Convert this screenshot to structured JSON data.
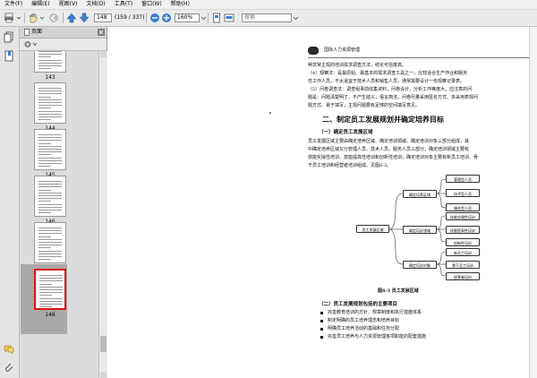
{
  "menu": [
    "文件(F)",
    "编辑(E)",
    "视图(V)",
    "文档(D)",
    "工具(T)",
    "窗口(W)",
    "帮助(H)"
  ],
  "toolbar": {
    "page_value": "148",
    "page_total": "(159 / 337)",
    "zoom": "160%",
    "search_placeholder": "搜索"
  },
  "panel": {
    "title": "页面"
  },
  "thumbnails": [
    {
      "label": "143",
      "selected": false
    },
    {
      "label": "144",
      "selected": false
    },
    {
      "label": "145",
      "selected": false
    },
    {
      "label": "146",
      "selected": false
    },
    {
      "label": "147",
      "selected": false
    },
    {
      "label": "148",
      "selected": true
    }
  ],
  "document": {
    "header": "国际人力资源管理",
    "para1": [
      "种非常主观的培训需求调查方法，结论可信度高。",
      "（4）观察法：是最原始、最基本的需求调查工具之一，比较适合生产作业和服务",
      "性工作人员，不太适宜于技术人员和销售人员，通常需要设计一份观察记录表。",
      "（5）问卷调查法：调查组事前收集资料，问卷设计，分析工作难度大，应注意的问",
      "题是：问题清楚明了、不产生歧义，语言简洁，问卷尽量采用匿名方式，多采用表现问",
      "题方式，易于填写；主观问题要有足够的空间填写意见。"
    ],
    "section_title": "二、制定员工发展规划并确定培养目标",
    "sub1": "（一）确定员工发展区域",
    "para2": [
      "员工发展区域主要由确定培养区域、确定培训领域、确定培训对象三部分组成，其",
      "中确定培养区域又分管理人员、技术人员、服务人员三部分；确定培训领域主要有",
      "技能实操性培训、技能提高性培训和创新性培训；确定培训对象主要有新员工培训、骨",
      "干员工培训和经营者培训组成。见图6-3。"
    ],
    "diagram": {
      "root": "员工发展区域",
      "branches": [
        {
          "label": "确定培养区域",
          "leaves": [
            "管理型人员",
            "技术型人员",
            "服务型人员"
          ]
        },
        {
          "label": "确定培训领域",
          "leaves": [
            "技能实操性培训",
            "技能提高性培训",
            "创新性培训"
          ]
        },
        {
          "label": "确定培训对象",
          "leaves": [
            "新员工培训",
            "骨干员工培训",
            "经营者培训"
          ]
        }
      ]
    },
    "caption": "图6-3   员工发展区域",
    "sub2": "（二）员工发展规划包括的主要项目",
    "bullets": [
      "完善教育培训的方针、规章制度和执行措施体系",
      "制定明确的员工培养理念和培养目标",
      "明确员工培养活动的基础和任务分配",
      "完善员工培养与人力资源管理各项职能的配套措施"
    ]
  }
}
